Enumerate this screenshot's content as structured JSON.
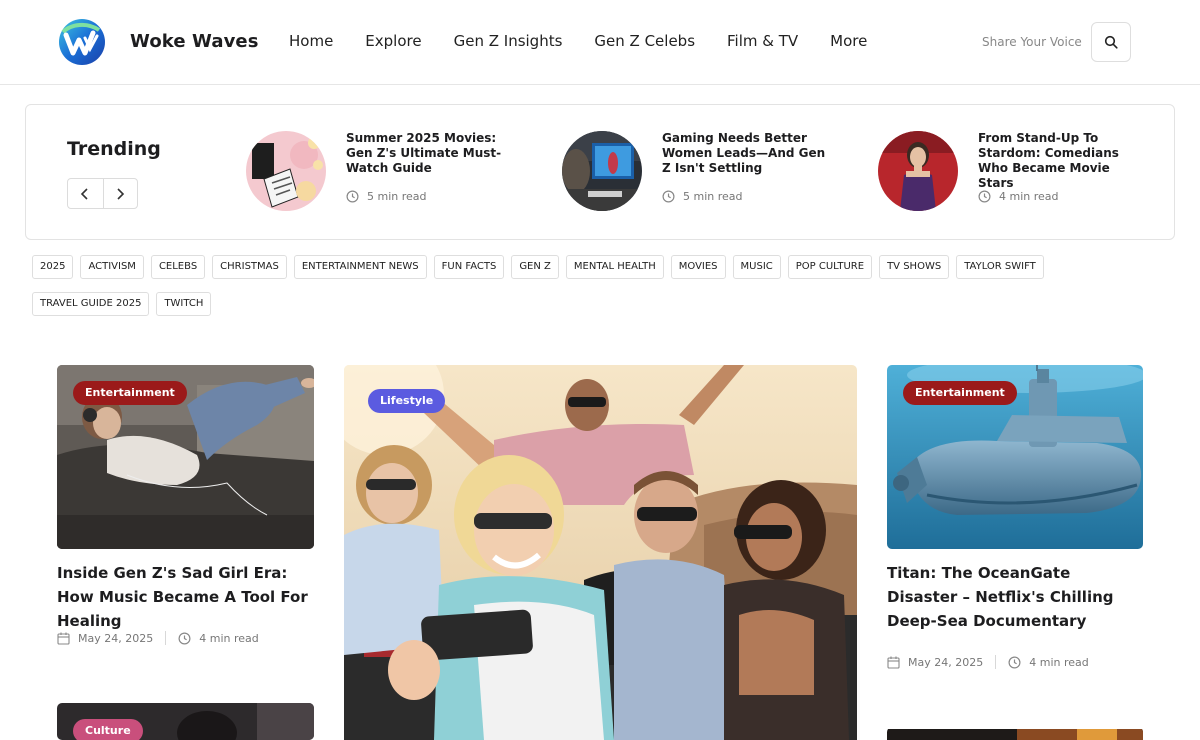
{
  "header": {
    "brand": "Woke Waves",
    "nav": [
      "Home",
      "Explore",
      "Gen Z Insights",
      "Gen Z Celebs",
      "Film & TV",
      "More"
    ],
    "share": "Share Your Voice",
    "search_icon": "search-icon"
  },
  "trending": {
    "title": "Trending",
    "items": [
      {
        "title": "Summer 2025 Movies: Gen Z's Ultimate Must-Watch Guide",
        "read": "5 min read"
      },
      {
        "title": "Gaming Needs Better Women Leads—And Gen Z Isn't Settling",
        "read": "5 min read"
      },
      {
        "title": "From Stand-Up To Stardom: Comedians Who Became Movie Stars",
        "read": "4 min read"
      }
    ]
  },
  "tags": [
    "2025",
    "ACTIVISM",
    "CELEBS",
    "CHRISTMAS",
    "ENTERTAINMENT NEWS",
    "FUN FACTS",
    "GEN Z",
    "MENTAL HEALTH",
    "MOVIES",
    "MUSIC",
    "POP CULTURE",
    "TV SHOWS",
    "TAYLOR SWIFT",
    "TRAVEL GUIDE 2025",
    "TWITCH"
  ],
  "cards": {
    "left": {
      "badge": "Entertainment",
      "title": "Inside Gen Z's Sad Girl Era: How Music Became A Tool For Healing",
      "date": "May 24, 2025",
      "read": "4 min read"
    },
    "center": {
      "badge": "Lifestyle"
    },
    "right": {
      "badge": "Entertainment",
      "title": "Titan: The OceanGate Disaster – Netflix's Chilling Deep-Sea Documentary",
      "date": "May 24, 2025",
      "read": "4 min read"
    },
    "left_bottom": {
      "badge": "Culture"
    }
  },
  "colors": {
    "entertainment": "#9b1a1a",
    "lifestyle": "#5b5be0",
    "culture": "#c94f7c"
  }
}
